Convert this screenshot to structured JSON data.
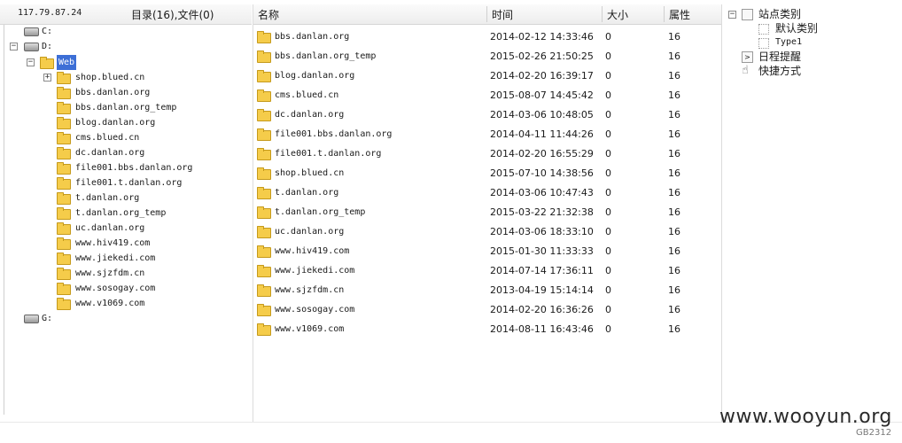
{
  "left_panel": {
    "server_ip": "117.79.87.24",
    "dir_summary": "目录(16),文件(0)",
    "tree": {
      "drive_c": "C:",
      "drive_d": "D:",
      "web_folder": "Web",
      "web_children": [
        "shop.blued.cn",
        "bbs.danlan.org",
        "bbs.danlan.org_temp",
        "blog.danlan.org",
        "cms.blued.cn",
        "dc.danlan.org",
        "file001.bbs.danlan.org",
        "file001.t.danlan.org",
        "t.danlan.org",
        "t.danlan.org_temp",
        "uc.danlan.org",
        "www.hiv419.com",
        "www.jiekedi.com",
        "www.sjzfdm.cn",
        "www.sosogay.com",
        "www.v1069.com"
      ],
      "drive_g": "G:"
    }
  },
  "file_list": {
    "columns": {
      "name": "名称",
      "time": "时间",
      "size": "大小",
      "attr": "属性"
    },
    "rows": [
      {
        "name": "bbs.danlan.org",
        "time": "2014-02-12 14:33:46",
        "size": "0",
        "attr": "16"
      },
      {
        "name": "bbs.danlan.org_temp",
        "time": "2015-02-26 21:50:25",
        "size": "0",
        "attr": "16"
      },
      {
        "name": "blog.danlan.org",
        "time": "2014-02-20 16:39:17",
        "size": "0",
        "attr": "16"
      },
      {
        "name": "cms.blued.cn",
        "time": "2015-08-07 14:45:42",
        "size": "0",
        "attr": "16"
      },
      {
        "name": "dc.danlan.org",
        "time": "2014-03-06 10:48:05",
        "size": "0",
        "attr": "16"
      },
      {
        "name": "file001.bbs.danlan.org",
        "time": "2014-04-11 11:44:26",
        "size": "0",
        "attr": "16"
      },
      {
        "name": "file001.t.danlan.org",
        "time": "2014-02-20 16:55:29",
        "size": "0",
        "attr": "16"
      },
      {
        "name": "shop.blued.cn",
        "time": "2015-07-10 14:38:56",
        "size": "0",
        "attr": "16"
      },
      {
        "name": "t.danlan.org",
        "time": "2014-03-06 10:47:43",
        "size": "0",
        "attr": "16"
      },
      {
        "name": "t.danlan.org_temp",
        "time": "2015-03-22 21:32:38",
        "size": "0",
        "attr": "16"
      },
      {
        "name": "uc.danlan.org",
        "time": "2014-03-06 18:33:10",
        "size": "0",
        "attr": "16"
      },
      {
        "name": "www.hiv419.com",
        "time": "2015-01-30 11:33:33",
        "size": "0",
        "attr": "16"
      },
      {
        "name": "www.jiekedi.com",
        "time": "2014-07-14 17:36:11",
        "size": "0",
        "attr": "16"
      },
      {
        "name": "www.sjzfdm.cn",
        "time": "2013-04-19 15:14:14",
        "size": "0",
        "attr": "16"
      },
      {
        "name": "www.sosogay.com",
        "time": "2014-02-20 16:36:26",
        "size": "0",
        "attr": "16"
      },
      {
        "name": "www.v1069.com",
        "time": "2014-08-11 16:43:46",
        "size": "0",
        "attr": "16"
      }
    ]
  },
  "right_panel": {
    "site_category": "站点类别",
    "default_category": "默认类别",
    "type1": "Type1",
    "schedule": "日程提醒",
    "shortcuts": "快捷方式"
  },
  "footer": {
    "watermark": "www.wooyun.org",
    "encoding": "GB2312"
  },
  "colors": {
    "selection": "#3d6fd6",
    "folder": "#f5cc4a"
  },
  "icons": {
    "drive": "drive-icon",
    "folder": "folder-icon",
    "expand": "plus-box-icon",
    "collapse": "minus-box-icon"
  }
}
